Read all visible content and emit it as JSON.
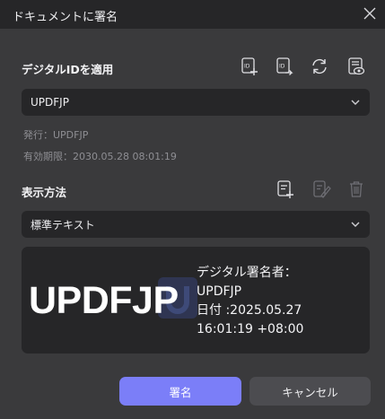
{
  "window": {
    "title": "ドキュメントに署名"
  },
  "digital_id": {
    "section_title": "デジタルIDを適用",
    "selected": "UPDFJP",
    "issuer": "発行：UPDFJP",
    "expiry": "有効期限：2030.05.28 08:01:19"
  },
  "display": {
    "section_title": "表示方法",
    "selected": "標準テキスト"
  },
  "preview": {
    "name": "UPDFJP",
    "lines": [
      "デジタル署名者：",
      "UPDFJP",
      "日付 :2025.05.27",
      "16:01:19 +08:00"
    ]
  },
  "buttons": {
    "sign": "署名",
    "cancel": "キャンセル"
  },
  "colors": {
    "accent": "#7b7ef8",
    "panel": "#262628",
    "background": "#3a3a3c"
  },
  "icons": [
    "close-icon",
    "create-id-icon",
    "import-id-icon",
    "refresh-icon",
    "view-id-icon",
    "add-appearance-icon",
    "edit-icon",
    "trash-icon",
    "chevron-down-icon"
  ]
}
